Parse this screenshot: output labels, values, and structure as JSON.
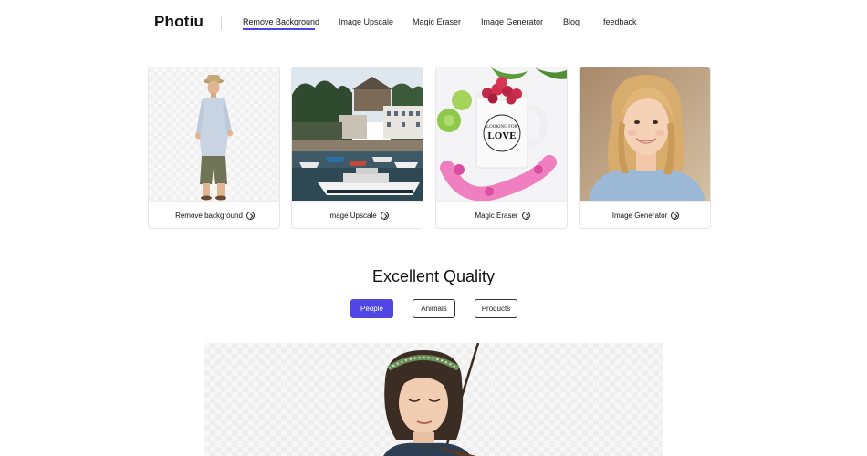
{
  "header": {
    "logo": "Photiu",
    "nav": [
      {
        "label": "Remove Background",
        "active": true
      },
      {
        "label": "Image Upscale",
        "active": false
      },
      {
        "label": "Magic Eraser",
        "active": false
      },
      {
        "label": "Image Generator",
        "active": false
      },
      {
        "label": "Blog",
        "active": false
      },
      {
        "label": "feedback",
        "active": false
      }
    ]
  },
  "cards": [
    {
      "label": "Remove background",
      "icon": "arrow-right-circle-icon"
    },
    {
      "label": "Image Upscale",
      "icon": "arrow-right-circle-icon"
    },
    {
      "label": "Magic Eraser",
      "icon": "arrow-right-circle-icon"
    },
    {
      "label": "Image Generator",
      "icon": "arrow-right-circle-icon"
    }
  ],
  "quality": {
    "title": "Excellent Quality",
    "filters": [
      {
        "label": "People",
        "active": true
      },
      {
        "label": "Animals",
        "active": false
      },
      {
        "label": "Products",
        "active": false
      }
    ]
  },
  "colors": {
    "accent": "#4f46e5",
    "mug_text": "LOOKING FOR LOVE"
  }
}
